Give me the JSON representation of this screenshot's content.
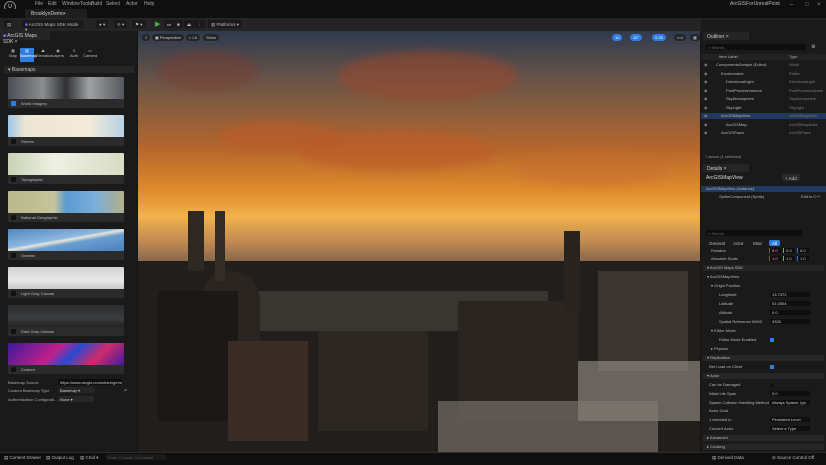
{
  "app": {
    "title": "ArcGISForUnrealPoint",
    "menu": [
      "File",
      "Edit",
      "Window",
      "Tools",
      "Build",
      "Select",
      "Actor",
      "Help"
    ],
    "document_tab": "BrooklynDemo•"
  },
  "toolbar": {
    "mode": "ArcGIS Maps SDK Mode",
    "platforms": "Platforms",
    "settings": "Settings"
  },
  "left_panel": {
    "tab": "ArcGIS Maps SDK",
    "modes": [
      "Map",
      "Basemap",
      "Elevation",
      "Layers",
      "Auth",
      "Camera"
    ],
    "active_mode": "Basemap",
    "section": "Basemaps",
    "basemaps": [
      {
        "name": "World Imagery",
        "checked": true
      },
      {
        "name": "Streets",
        "checked": false
      },
      {
        "name": "Topographic",
        "checked": false
      },
      {
        "name": "National Geographic",
        "checked": false
      },
      {
        "name": "Oceans",
        "checked": false
      },
      {
        "name": "Light Gray Canvas",
        "checked": false
      },
      {
        "name": "Dark Gray Canvas",
        "checked": false
      },
      {
        "name": "Custom",
        "checked": false
      }
    ],
    "props": {
      "source_label": "Basemap Source",
      "source_value": "https://www.arcgis.com/sharing/rest",
      "type_label": "Custom Basemap Type",
      "type_value": "Basemap",
      "auth_label": "Authentication Configurati...",
      "auth_value": "None"
    }
  },
  "viewport": {
    "perspective": "Perspective",
    "lit": "Lit",
    "show": "Show",
    "snap_values": [
      "10",
      "10°",
      "0.25",
      "4"
    ]
  },
  "outliner": {
    "tab": "Outliner",
    "search_placeholder": "Search...",
    "col_label": "Item Label",
    "col_type": "Type",
    "items": [
      {
        "label": "ComponentsSample (Editor)",
        "type": "World",
        "indent": 1
      },
      {
        "label": "Environment",
        "type": "Folder",
        "indent": 2
      },
      {
        "label": "DirectionalLight",
        "type": "DirectionalLight",
        "indent": 3
      },
      {
        "label": "PostProcessVolume",
        "type": "PostProcessVolume",
        "indent": 3
      },
      {
        "label": "SkyAtmosphere",
        "type": "SkyAtmosphere",
        "indent": 3
      },
      {
        "label": "SkyLight",
        "type": "SkyLight",
        "indent": 3
      },
      {
        "label": "ArcGISMapView",
        "type": "ArcGISMapView",
        "indent": 2,
        "selected": true
      },
      {
        "label": "ArcGISMap",
        "type": "ArcGISMapActor",
        "indent": 3
      },
      {
        "label": "ArcGISPawn",
        "type": "ArcGISPawn",
        "indent": 2
      }
    ],
    "footer": "7 actors (1 selected)"
  },
  "details": {
    "tab": "Details",
    "actor": "ArcGISMapView",
    "add": "+ Add",
    "instance": "ArcGISMapView (Instance)",
    "component": "SpriteComponent (Sprite)",
    "edit_cpp": "Edit in C++",
    "search_placeholder": "Search",
    "filters": [
      "General",
      "Actor",
      "Misc",
      "All"
    ],
    "active_filter": "All",
    "transform": [
      {
        "label": "Rotation",
        "values": [
          "0.0",
          "0.0",
          "0.0"
        ]
      },
      {
        "label": "Absolute Scale",
        "values": [
          "1.0",
          "1.0",
          "1.0"
        ]
      }
    ],
    "sections": {
      "sdk": "ArcGIS Maps SDK",
      "mapview": "ArcGISMapView",
      "origin": "Origin Position",
      "editor_mode": "Editor Mode",
      "editor_mode_enabled": "Editor Mode Enabled",
      "physics": "Physics",
      "replication": "Replication",
      "net_load": "Net Load on Client",
      "actor": "Actor",
      "advanced": "Advanced",
      "cooking": "Cooking"
    },
    "origin": [
      {
        "label": "Longitude",
        "value": "13.7372"
      },
      {
        "label": "Latitude",
        "value": "51.0504"
      },
      {
        "label": "Altitude",
        "value": "0.0"
      },
      {
        "label": "Spatial Reference WKID",
        "value": "4326"
      }
    ],
    "actor_props": [
      {
        "label": "Can be Damaged",
        "value": ""
      },
      {
        "label": "Initial Life Span",
        "value": "0.0"
      },
      {
        "label": "Spawn Collision Handling Method",
        "value": "Always Spawn, Ign"
      },
      {
        "label": "Actor Guid",
        "value": ""
      },
      {
        "label": "1 selected in",
        "value": "Persistent Level"
      },
      {
        "label": "Convert Actor",
        "value": "Select a Type"
      }
    ]
  },
  "status": {
    "content_drawer": "Content Drawer",
    "output_log": "Output Log",
    "cmd": "Cmd",
    "console_placeholder": "Enter Console Command",
    "derived_data": "Derived Data",
    "source_control": "Source Control Off"
  },
  "colors": {
    "accent": "#2f7de1",
    "panel": "#1a1a1a",
    "selected_row": "#1f3a5e"
  }
}
